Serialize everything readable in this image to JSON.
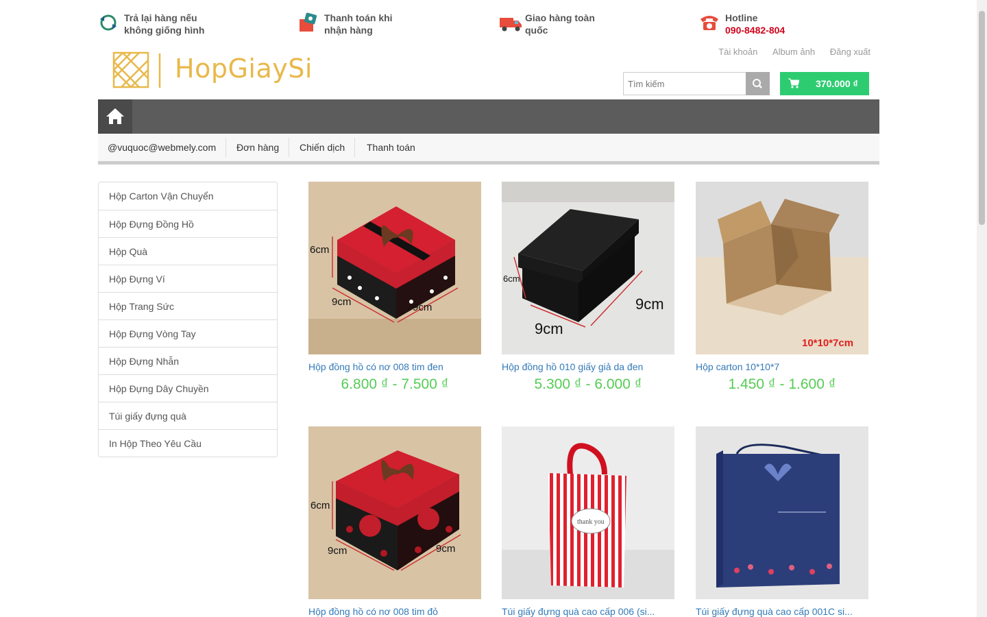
{
  "benefits": [
    {
      "icon": "refresh-icon",
      "line1": "Trả lại hàng nếu",
      "line2": "không giống hình"
    },
    {
      "icon": "cash-payment-icon",
      "line1": "Thanh toán khi",
      "line2": "nhận hàng"
    },
    {
      "icon": "delivery-truck-icon",
      "line1": "Giao hàng toàn",
      "line2": "quốc"
    },
    {
      "icon": "phone-icon",
      "line1": "Hotline",
      "line2": "090-8482-804"
    }
  ],
  "account": {
    "account": "Tài khoản",
    "album": "Album ảnh",
    "logout": "Đăng xuất"
  },
  "logo": {
    "text": "HopGiaySi"
  },
  "search": {
    "placeholder": "Tìm kiếm"
  },
  "cart": {
    "total": "370.000 ₫"
  },
  "subnav": [
    "@vuquoc@webmely.com",
    "Đơn hàng",
    "Chiến dịch",
    "Thanh toán"
  ],
  "categories": [
    "Hộp Carton Vận Chuyển",
    "Hộp Đựng Đồng Hồ",
    "Hộp Quà",
    "Hộp Đựng Ví",
    "Hộp Trang Sức",
    "Hộp Đựng Vòng Tay",
    "Hộp Đựng Nhẫn",
    "Hộp Đựng Dây Chuyền",
    "Túi giấy đựng quà",
    "In Hộp Theo Yêu Cầu"
  ],
  "products": [
    {
      "name": "Hộp đồng hồ có nơ 008 tim đen",
      "price": "6.800 ₫ - 7.500 ₫",
      "labels": [
        "6cm",
        "9cm",
        "9cm"
      ]
    },
    {
      "name": "Hộp đồng hồ 010 giấy giả da đen",
      "price": "5.300 ₫ - 6.000 ₫",
      "labels": [
        "6cm",
        "9cm",
        "9cm"
      ]
    },
    {
      "name": "Hộp carton 10*10*7",
      "price": "1.450 ₫ - 1.600 ₫",
      "labels": [
        "10*10*7cm"
      ]
    },
    {
      "name": "Hộp đồng hồ có nơ 008 tim đỏ",
      "price": "",
      "labels": [
        "6cm",
        "9cm",
        "9cm"
      ]
    },
    {
      "name": "Túi giấy đựng quà cao cấp 006 (si...",
      "price": "",
      "labels": [
        "thank you"
      ]
    },
    {
      "name": "Túi giấy đựng quà cao cấp 001C si...",
      "price": "",
      "labels": []
    }
  ]
}
